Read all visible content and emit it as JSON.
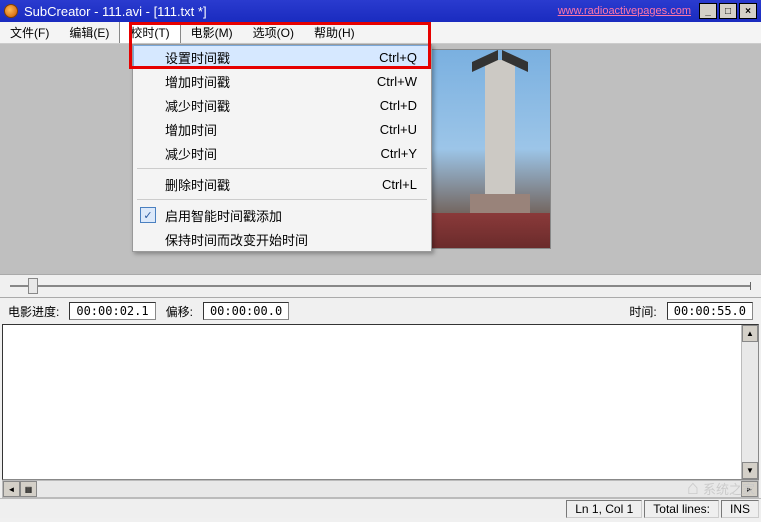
{
  "window": {
    "title": "SubCreator - 111.avi - [111.txt *]",
    "url": "www.radioactivepages.com"
  },
  "menu": {
    "items": [
      "文件(F)",
      "编辑(E)",
      "校时(T)",
      "电影(M)",
      "选项(O)",
      "帮助(H)"
    ],
    "active_index": 2
  },
  "dropdown": {
    "items": [
      {
        "label": "设置时间戳",
        "shortcut": "Ctrl+Q",
        "hover": true
      },
      {
        "label": "增加时间戳",
        "shortcut": "Ctrl+W"
      },
      {
        "label": "减少时间戳",
        "shortcut": "Ctrl+D"
      },
      {
        "label": "增加时间",
        "shortcut": "Ctrl+U"
      },
      {
        "label": "减少时间",
        "shortcut": "Ctrl+Y"
      },
      {
        "sep": true
      },
      {
        "label": "删除时间戳",
        "shortcut": "Ctrl+L"
      },
      {
        "sep": true
      },
      {
        "label": "启用智能时间戳添加",
        "checked": true
      },
      {
        "label": "保持时间而改变开始时间"
      }
    ]
  },
  "info": {
    "progress_label": "电影进度:",
    "progress_value": "00:00:02.1",
    "offset_label": "偏移:",
    "offset_value": "00:00:00.0",
    "time_label": "时间:",
    "time_value": "00:00:55.0"
  },
  "status": {
    "pos": "Ln 1, Col 1",
    "total": "Total lines:",
    "mode": "INS"
  },
  "watermark": "系统之家"
}
